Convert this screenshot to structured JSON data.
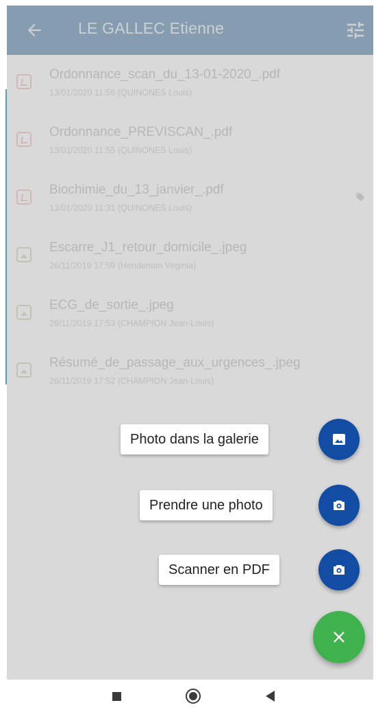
{
  "appbar": {
    "title": "LE GALLEC Etienne"
  },
  "documents": [
    {
      "name": "Ordonnance_scan_du_13-01-2020_.pdf",
      "meta": "13/01/2020 11:56 (QUINONES Louis)",
      "type": "pdf",
      "tagged": false
    },
    {
      "name": "Ordonnance_PREVISCAN_.pdf",
      "meta": "13/01/2020 11:55 (QUINONES Louis)",
      "type": "pdf",
      "tagged": false
    },
    {
      "name": "Biochimie_du_13_janvier_.pdf",
      "meta": "13/01/2020 11:31 (QUINONES Louis)",
      "type": "pdf",
      "tagged": true
    },
    {
      "name": "Escarre_J1_retour_domicile_.jpeg",
      "meta": "26/11/2019 17:59 (Henderson Virginia)",
      "type": "image",
      "tagged": false
    },
    {
      "name": "ECG_de_sortie_.jpeg",
      "meta": "26/11/2019 17:53 (CHAMPION Jean-Louis)",
      "type": "image",
      "tagged": false
    },
    {
      "name": "Résumé_de_passage_aux_urgences_.jpeg",
      "meta": "26/11/2019 17:52 (CHAMPION Jean-Louis)",
      "type": "image",
      "tagged": false
    }
  ],
  "speed_dial": {
    "gallery_label": "Photo dans la galerie",
    "photo_label": "Prendre une photo",
    "scan_label": "Scanner en PDF"
  },
  "colors": {
    "appbar": "#7fa0bf",
    "mini_fab": "#124da3",
    "main_fab": "#3fb24e"
  }
}
